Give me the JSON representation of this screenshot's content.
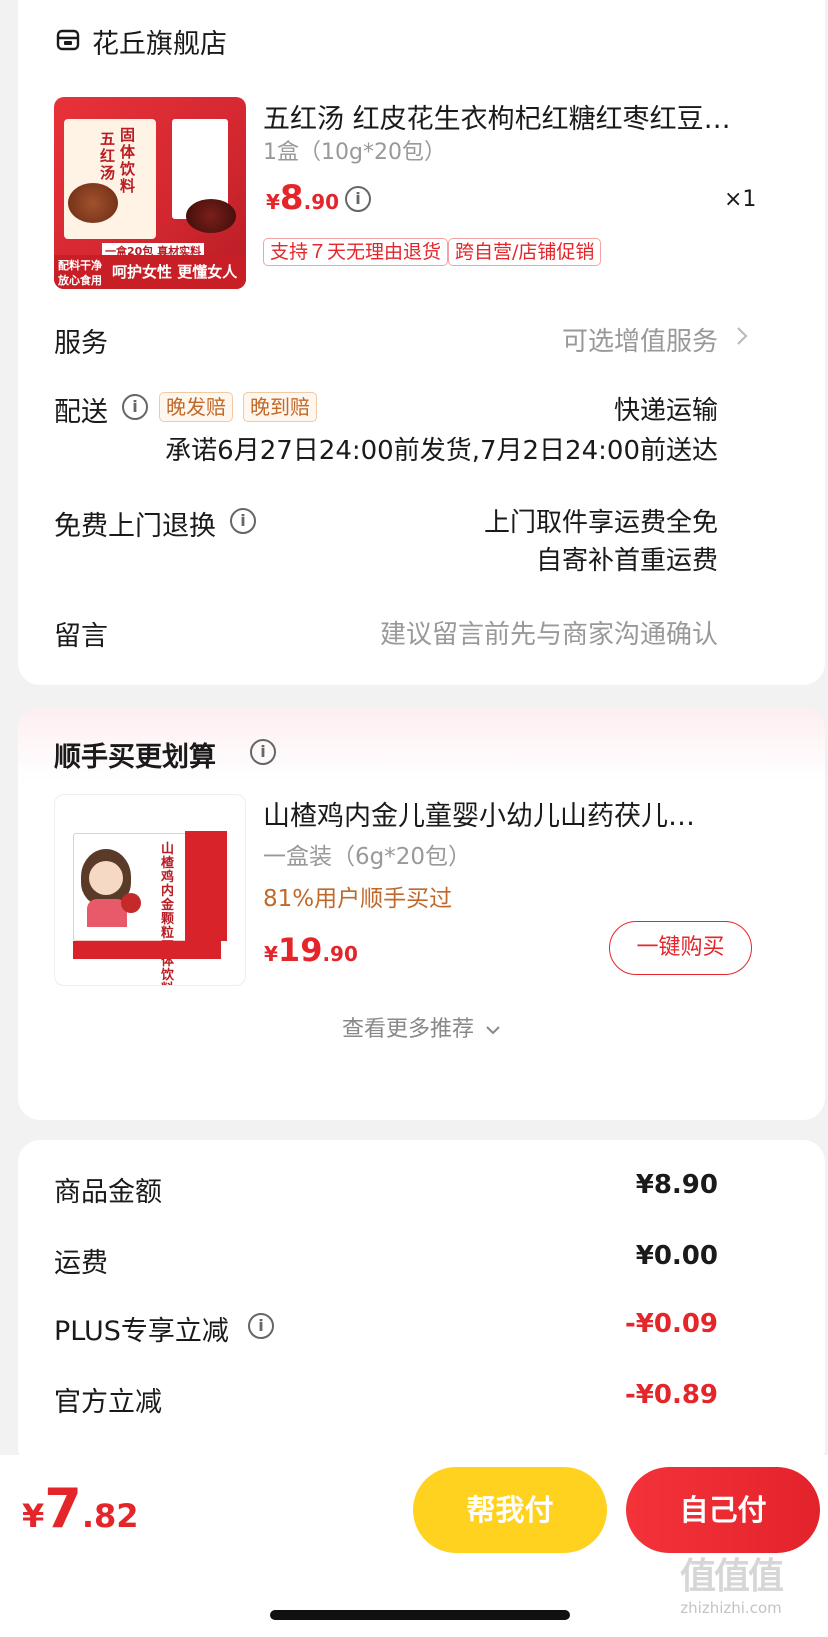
{
  "shop": {
    "name": "花丘旗舰店"
  },
  "product": {
    "title": "五红汤 红皮花生衣枸杞红糖红枣红豆…",
    "spec": "1盒（10g*20包）",
    "price_symbol": "¥",
    "price_int": "8",
    "price_dec": ".90",
    "qty": "×1",
    "tags": [
      "支持７天无理由退货",
      "跨自营/店铺促销"
    ],
    "thumb_texts": {
      "a": "固体饮料",
      "b": "五红汤",
      "c": "一盒20包 真材实料",
      "d": "配料干净",
      "e": "放心食用",
      "f": "呵护女性 更懂女人"
    }
  },
  "rows": {
    "service_label": "服务",
    "service_value": "可选增值服务",
    "delivery_label": "配送",
    "delivery_tags": [
      "晚发赔",
      "晚到赔"
    ],
    "delivery_method": "快递运输",
    "delivery_promise": "承诺6月27日24:00前发货,7月2日24:00前送达",
    "return_label": "免费上门退换",
    "return_line1": "上门取件享运费全免",
    "return_line2": "自寄补首重运费",
    "note_label": "留言",
    "note_placeholder": "建议留言前先与商家沟通确认"
  },
  "recommend": {
    "title": "顺手买更划算",
    "item_title": "山楂鸡内金儿童婴小幼儿山药茯儿…",
    "item_spec": "一盒装（6g*20包）",
    "item_stat": "81%用户顺手买过",
    "price_symbol": "¥",
    "price_int": "19",
    "price_dec": ".90",
    "buy_button": "一键购买",
    "more": "查看更多推荐",
    "thumb_text": "山楂鸡内金颗粒固体饮料"
  },
  "summary": {
    "goods_label": "商品金额",
    "goods_value": "¥8.90",
    "shipping_label": "运费",
    "shipping_value": "¥0.00",
    "plus_label": "PLUS专享立减",
    "plus_value": "-¥0.09",
    "official_label": "官方立减",
    "official_value": "-¥0.89"
  },
  "footer": {
    "price_symbol": "¥",
    "price_int": "7",
    "price_dec": ".82",
    "help_pay": "帮我付",
    "self_pay": "自己付"
  },
  "watermark": {
    "text": "值值值",
    "url_text": "zhizhizhi.com"
  },
  "colors": {
    "red": "#e4262b",
    "yellow": "#ffd21f",
    "orange_text": "#c0692a"
  }
}
